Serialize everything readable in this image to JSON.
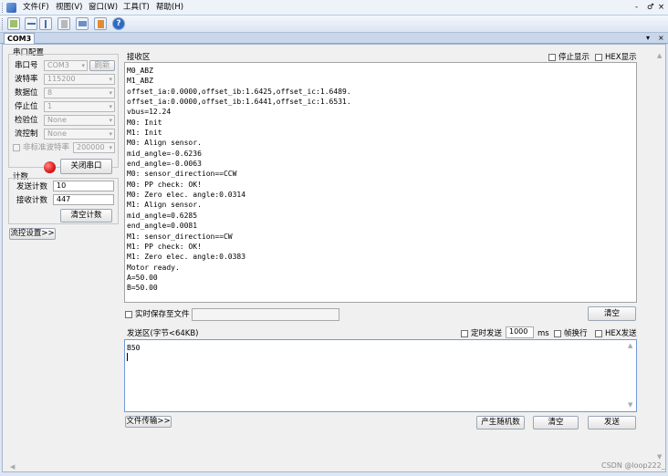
{
  "menubar": {
    "items": [
      "文件(F)",
      "视图(V)",
      "窗口(W)",
      "工具(T)",
      "帮助(H)"
    ],
    "controls": [
      "-",
      "♂",
      "×"
    ]
  },
  "tab": {
    "label": "COM3",
    "controls": [
      "▾",
      "×"
    ]
  },
  "serial_config": {
    "title": "串口配置",
    "port_label": "串口号",
    "port_value": "COM3",
    "refresh_label": "刷新",
    "baud_label": "波特率",
    "baud_value": "115200",
    "databits_label": "数据位",
    "databits_value": "8",
    "stopbits_label": "停止位",
    "stopbits_value": "1",
    "parity_label": "检验位",
    "parity_value": "None",
    "flow_label": "流控制",
    "flow_value": "None",
    "nonstd_label": "非标准波特率",
    "nonstd_value": "200000",
    "close_port_label": "关闭串口",
    "status_color": "#e02020"
  },
  "counter": {
    "title": "计数",
    "sent_label": "发送计数",
    "sent_value": "10",
    "recv_label": "接收计数",
    "recv_value": "447",
    "clear_label": "清空计数"
  },
  "flow_settings_label": "流控设置>>",
  "receive": {
    "title": "接收区",
    "stop_display_label": "停止显示",
    "hex_display_label": "HEX显示",
    "lines": [
      "M0_ABZ",
      "M1_ABZ",
      "offset_ia:0.0000,offset_ib:1.6425,offset_ic:1.6489.",
      "offset_ia:0.0000,offset_ib:1.6441,offset_ic:1.6531.",
      "vbus=12.24",
      "M0: Init",
      "M1: Init",
      "M0: Align sensor.",
      "mid_angle=-0.6236",
      "end_angle=-0.0063",
      "M0: sensor_direction==CCW",
      "M0: PP check: OK!",
      "M0: Zero elec. angle:0.0314",
      "M1: Align sensor.",
      "mid_angle=0.6285",
      "end_angle=0.0081",
      "M1: sensor_direction==CW",
      "M1: PP check: OK!",
      "M1: Zero elec. angle:0.0383",
      "Motor ready.",
      "A=50.00",
      "B=50.00"
    ],
    "save_to_file_label": "实时保存至文件",
    "clear_label": "清空"
  },
  "send": {
    "title": "发送区(字节<64KB)",
    "timed_send_label": "定时发送",
    "interval_value": "1000",
    "interval_unit": "ms",
    "newline_label": "帧换行",
    "hex_send_label": "HEX发送",
    "content": "B50",
    "file_transfer_label": "文件传输>>",
    "random_label": "产生随机数",
    "clear_label": "清空",
    "send_label": "发送"
  },
  "watermark": "CSDN @loop222_"
}
